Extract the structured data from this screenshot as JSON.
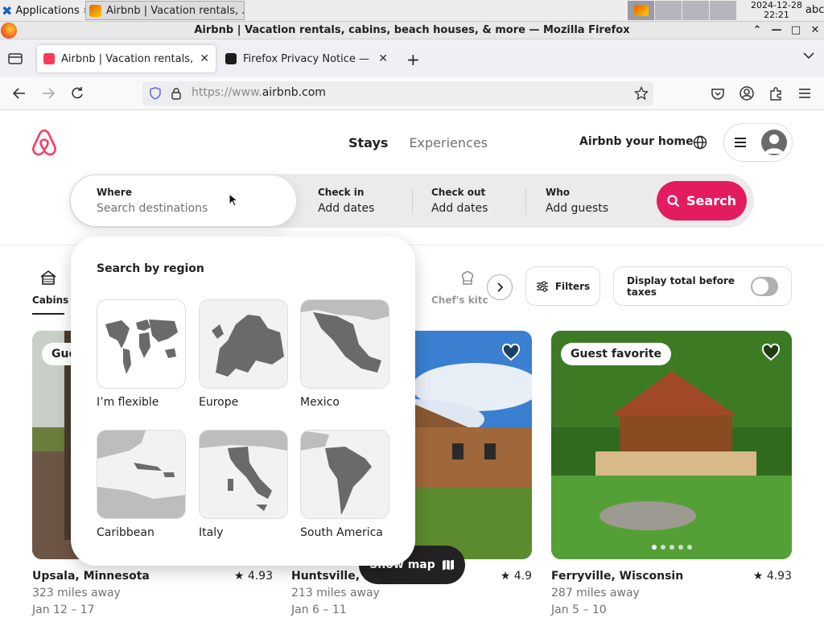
{
  "os": {
    "applications_label": "Applications",
    "window_title": "Airbnb | Vacation rentals, ...",
    "clock_date": "2024-12-28",
    "clock_time": "22:21",
    "keyboard": "abc"
  },
  "browser": {
    "title": "Airbnb | Vacation rentals, cabins, beach houses, & more — Mozilla Firefox",
    "tabs": [
      {
        "label": "Airbnb | Vacation rentals, c",
        "active": true
      },
      {
        "label": "Firefox Privacy Notice — M",
        "active": false
      }
    ],
    "url_prefix": "https://www.",
    "url_domain": "airbnb.com"
  },
  "header": {
    "tab_stays": "Stays",
    "tab_experiences": "Experiences",
    "host_link": "Airbnb your home"
  },
  "search": {
    "where_label": "Where",
    "where_placeholder": "Search destinations",
    "checkin_label": "Check in",
    "checkin_value": "Add dates",
    "checkout_label": "Check out",
    "checkout_value": "Add dates",
    "who_label": "Who",
    "who_value": "Add guests",
    "button_label": "Search"
  },
  "categories": {
    "first": "Cabins",
    "partial": "Chef's kitch"
  },
  "filters_label": "Filters",
  "taxes_label": "Display total before taxes",
  "region_panel": {
    "title": "Search by region",
    "regions": [
      {
        "label": "I’m flexible",
        "map": "world"
      },
      {
        "label": "Europe",
        "map": "europe"
      },
      {
        "label": "Mexico",
        "map": "mexico"
      },
      {
        "label": "Caribbean",
        "map": "caribbean"
      },
      {
        "label": "Italy",
        "map": "italy"
      },
      {
        "label": "South America",
        "map": "south-america"
      }
    ]
  },
  "listings": [
    {
      "title": "Upsala, Minnesota",
      "rating": "4.93",
      "distance": "323 miles away",
      "dates": "Jan 12 – 17",
      "badge": "Gue"
    },
    {
      "title": "Huntsville, M",
      "rating": "4.9",
      "distance": "213 miles away",
      "dates": "Jan 6 – 11",
      "badge": ""
    },
    {
      "title": "Ferryville, Wisconsin",
      "rating": "4.93",
      "distance": "287 miles away",
      "dates": "Jan 5 – 10",
      "badge": "Guest favorite"
    }
  ],
  "show_map_label": "Show map",
  "colors": {
    "brand": "#ff385c",
    "search_button": "#e31c5f"
  }
}
